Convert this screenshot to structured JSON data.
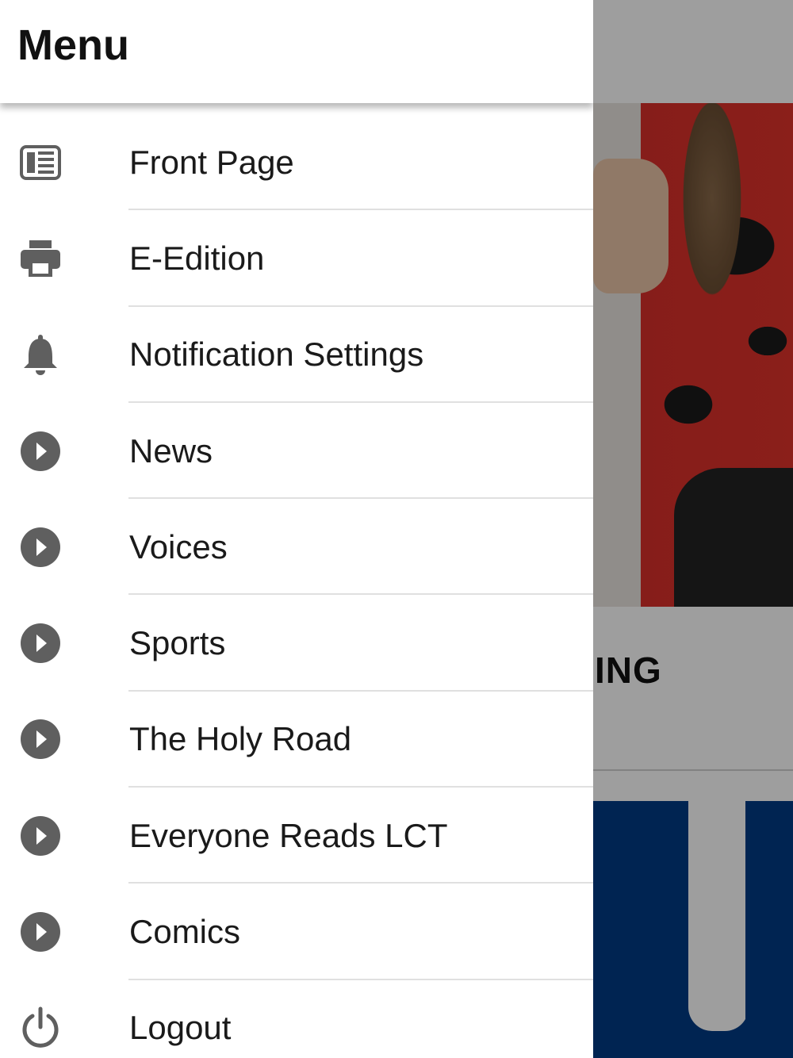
{
  "background": {
    "headline_fragment": "ING"
  },
  "drawer": {
    "title": "Menu",
    "items": [
      {
        "label": "Front Page",
        "icon": "newspaper-icon"
      },
      {
        "label": "E-Edition",
        "icon": "printer-icon"
      },
      {
        "label": "Notification Settings",
        "icon": "bell-icon"
      },
      {
        "label": "News",
        "icon": "play-circle-icon"
      },
      {
        "label": "Voices",
        "icon": "play-circle-icon"
      },
      {
        "label": "Sports",
        "icon": "play-circle-icon"
      },
      {
        "label": "The Holy Road",
        "icon": "play-circle-icon"
      },
      {
        "label": "Everyone Reads LCT",
        "icon": "play-circle-icon"
      },
      {
        "label": "Comics",
        "icon": "play-circle-icon"
      },
      {
        "label": "Logout",
        "icon": "power-icon"
      }
    ]
  },
  "colors": {
    "icon": "#5f5f5f",
    "text": "#1a1a1a",
    "divider": "#e0e0e0",
    "logo_blue": "#003b85"
  }
}
